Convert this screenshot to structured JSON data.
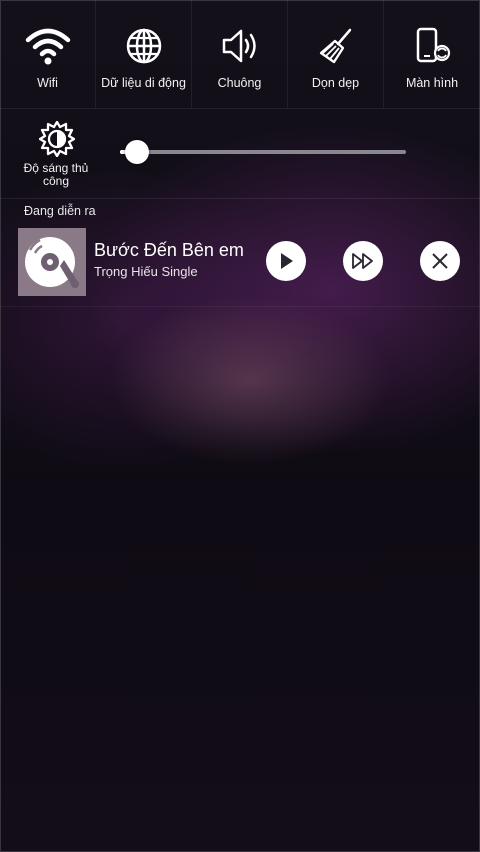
{
  "quick_toggles": [
    {
      "label": "Wifi",
      "icon": "wifi-icon"
    },
    {
      "label": "Dữ liệu di động",
      "icon": "globe-icon"
    },
    {
      "label": "Chuông",
      "icon": "speaker-icon"
    },
    {
      "label": "Dọn dẹp",
      "icon": "broom-icon"
    },
    {
      "label": "Màn hình",
      "icon": "screen-rotate-icon"
    }
  ],
  "brightness": {
    "label": "Độ sáng thủ công",
    "icon": "brightness-icon",
    "level": 0.06
  },
  "now_playing": {
    "section_label": "Đang diễn ra",
    "song_title": "Bước Đến Bên em",
    "artist": "Trọng Hiếu Single",
    "album_icon": "vinyl-disc-icon",
    "controls": {
      "play_icon": "play-icon",
      "next_icon": "fast-forward-icon",
      "close_icon": "close-icon"
    }
  },
  "colors": {
    "background": "#120e17",
    "accent_purple": "#6e2878",
    "slider_track": "#8a8690",
    "album_bg": "#8a7a88"
  }
}
